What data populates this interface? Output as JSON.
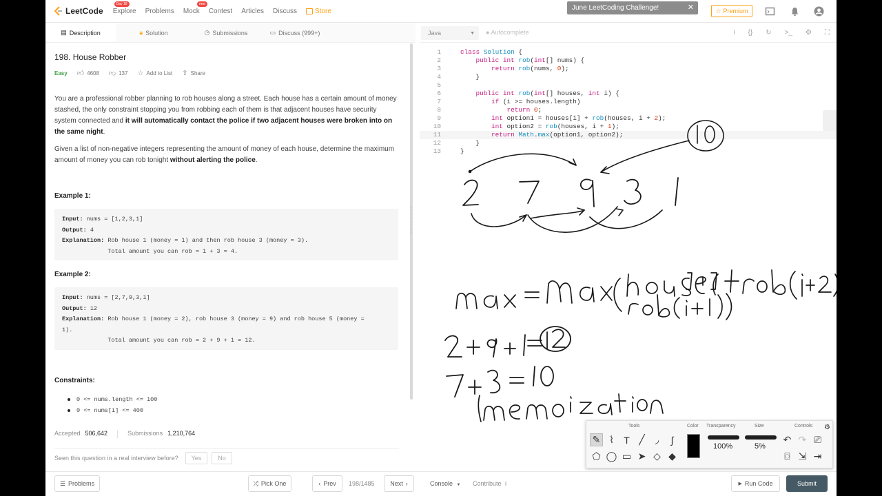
{
  "nav": {
    "logo": "LeetCode",
    "items": [
      "Explore",
      "Problems",
      "Mock",
      "Contest",
      "Articles",
      "Discuss"
    ],
    "explore_badge": "Day 18",
    "mock_badge": "new",
    "store": "Store",
    "challenge": "June LeetCoding Challenge!",
    "premium": "Premium"
  },
  "tabs": {
    "description": "Description",
    "solution": "Solution",
    "submissions": "Submissions",
    "discuss": "Discuss (999+)"
  },
  "problem": {
    "title": "198. House Robber",
    "difficulty": "Easy",
    "likes": "4608",
    "dislikes": "137",
    "add_to_list": "Add to List",
    "share": "Share",
    "para1_a": "You are a professional robber planning to rob houses along a street. Each house has a certain amount of money stashed, the only constraint stopping you from robbing each of them is that adjacent houses have security system connected and ",
    "para1_b": "it will automatically contact the police if two adjacent houses were broken into on the same night",
    "para1_c": ".",
    "para2_a": "Given a list of non-negative integers representing the amount of money of each house, determine the maximum amount of money you can rob tonight ",
    "para2_b": "without alerting the police",
    "para2_c": ".",
    "example1_title": "Example 1:",
    "example1": {
      "input_label": "Input:",
      "input": " nums = [1,2,3,1]",
      "output_label": "Output:",
      "output": " 4",
      "explanation_label": "Explanation:",
      "explanation": " Rob house 1 (money = 1) and then rob house 3 (money = 3).\n             Total amount you can rob = 1 + 3 = 4."
    },
    "example2_title": "Example 2:",
    "example2": {
      "input_label": "Input:",
      "input": " nums = [2,7,9,3,1]",
      "output_label": "Output:",
      "output": " 12",
      "explanation_label": "Explanation:",
      "explanation": " Rob house 1 (money = 2), rob house 3 (money = 9) and rob house 5 (money =\n1).\n             Total amount you can rob = 2 + 9 + 1 = 12."
    },
    "constraints_title": "Constraints:",
    "constraints": [
      "0 <= nums.length <= 100",
      "0 <= nums[i] <= 400"
    ],
    "accepted_label": "Accepted",
    "accepted": "506,642",
    "submissions_label": "Submissions",
    "submissions": "1,210,764",
    "seen_question": "Seen this question in a real interview before?",
    "yes": "Yes",
    "no": "No"
  },
  "editor": {
    "language": "Java",
    "autocomplete": "Autocomplete",
    "lines": [
      "class Solution {",
      "    public int rob(int[] nums) {",
      "        return rob(nums, 0);",
      "    }",
      "",
      "    public int rob(int[] houses, int i) {",
      "        if (i >= houses.length)",
      "            return 0;",
      "        int option1 = houses[i] + rob(houses, i + 2);",
      "        int option2 = rob(houses, i + 1);",
      "        return Math.max(option1, option2);",
      "    }",
      "}"
    ],
    "line_numbers": [
      "1",
      "2",
      "3",
      "4",
      "5",
      "6",
      "7",
      "8",
      "9",
      "10",
      "11",
      "12",
      "13"
    ]
  },
  "bottom": {
    "problems": "Problems",
    "pick_one": "Pick One",
    "prev": "Prev",
    "page": "198/1485",
    "next": "Next",
    "console": "Console",
    "contribute": "Contribute",
    "run_code": "Run Code",
    "submit": "Submit"
  },
  "tools_panel": {
    "tools_label": "Tools",
    "color_label": "Color",
    "transparency_label": "Transparency",
    "size_label": "Size",
    "controls_label": "Controls",
    "transparency": "100%",
    "size": "5%",
    "selected_color": "#000000"
  },
  "colors": {
    "accent": "#ffa116",
    "easy": "#43a047",
    "submit": "#455a64"
  }
}
